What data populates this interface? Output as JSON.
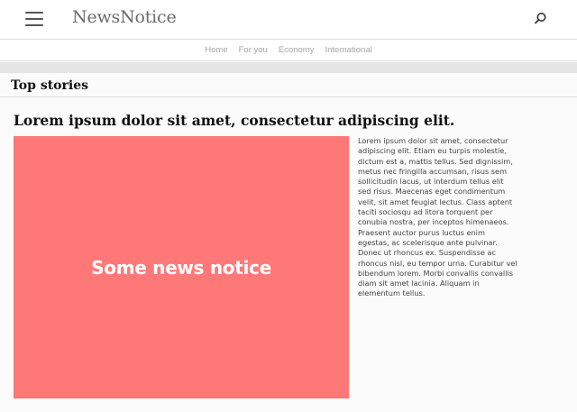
{
  "header": {
    "brand": "NewsNotice",
    "menu_icon": "hamburger-menu-icon",
    "search_icon": "search-icon"
  },
  "nav": {
    "items": [
      {
        "label": "Home"
      },
      {
        "label": "For you"
      },
      {
        "label": "Economy"
      },
      {
        "label": "International"
      }
    ]
  },
  "section": {
    "title": "Top stories"
  },
  "article": {
    "headline": "Lorem ipsum dolor sit amet, consectetur adipiscing elit.",
    "image_text": "Some news notice",
    "body": "Lorem ipsum dolor sit amet, consectetur adipiscing elit. Etiam eu turpis molestie, dictum est a, mattis tellus. Sed dignissim, metus nec fringilla accumsan, risus sem sollicitudin lacus, ut interdum tellus elit sed risus. Maecenas eget condimentum velit, sit amet feugiat lectus. Class aptent taciti sociosqu ad litora torquent per conubia nostra, per inceptos himenaeos. Praesent auctor purus luctus enim egestas, ac scelerisque ante pulvinar. Donec ut rhoncus ex. Suspendisse ac rhoncus nisl, eu tempor urna. Curabitur vel bibendum lorem. Morbi convallis convallis diam sit amet lacinia. Aliquam in elementum tellus."
  },
  "colors": {
    "image_background": "#ff7878",
    "nav_text": "#a6a6a6",
    "band": "#e5e5e5"
  }
}
